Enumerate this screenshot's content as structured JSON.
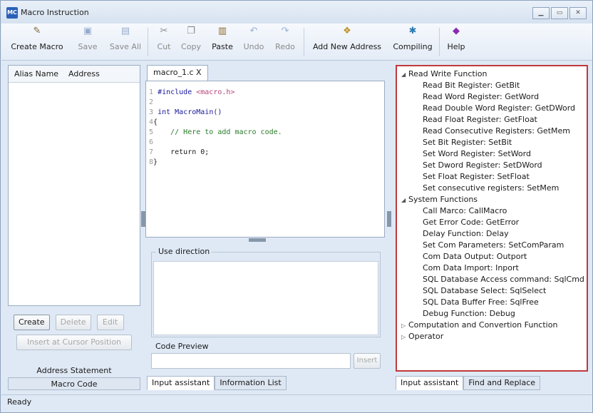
{
  "window": {
    "title": "Macro Instruction",
    "app_icon_text": "MC"
  },
  "toolbar": {
    "create_macro": "Create Macro",
    "save": "Save",
    "save_all": "Save All",
    "cut": "Cut",
    "copy": "Copy",
    "paste": "Paste",
    "undo": "Undo",
    "redo": "Redo",
    "add_new_address": "Add New Address",
    "compiling": "Compiling",
    "help": "Help"
  },
  "address_panel": {
    "col_alias": "Alias Name",
    "col_address": "Address",
    "create": "Create",
    "delete": "Delete",
    "edit": "Edit",
    "insert_at_cursor": "Insert at Cursor Position",
    "statement_label": "Address Statement",
    "tab_macro_code": "Macro Code"
  },
  "editor": {
    "tab_name": "macro_1.c X",
    "lines": [
      {
        "num": "1",
        "pre": "#include ",
        "str": "<macro.h>"
      },
      {
        "num": "2"
      },
      {
        "num": "3",
        "kw": "int ",
        "text": "MacroMain()"
      },
      {
        "num": "4",
        "text": "{"
      },
      {
        "num": "5",
        "cm": "    // Here to add macro code."
      },
      {
        "num": "6"
      },
      {
        "num": "7",
        "text": "    return 0;"
      },
      {
        "num": "8",
        "text": "}"
      }
    ],
    "use_direction_label": "Use direction",
    "code_preview_label": "Code Preview",
    "insert_btn": "Insert",
    "tab_input_assistant": "Input assistant",
    "tab_information_list": "Information List"
  },
  "function_tree": {
    "groups": [
      {
        "label": "Read Write Function",
        "expanded": true,
        "items": [
          "Read Bit Register: GetBit",
          "Read Word Register: GetWord",
          "Read Double Word Register: GetDWord",
          "Read Float Register: GetFloat",
          "Read Consecutive Registers: GetMem",
          "Set Bit Register: SetBit",
          "Set Word Register: SetWord",
          "Set Dword Register: SetDWord",
          "Set Float Register: SetFloat",
          "Set consecutive registers: SetMem"
        ]
      },
      {
        "label": "System Functions",
        "expanded": true,
        "items": [
          "Call Marco: CallMacro",
          "Get Error Code: GetError",
          "Delay Function: Delay",
          "Set Com Parameters: SetComParam",
          "Com Data Output: Outport",
          "Com Data Import: Inport",
          "SQL Database Access command: SqlCmd",
          "SQL Database Select: SqlSelect",
          "SQL Data Buffer Free: SqlFree",
          "Debug Function: Debug"
        ]
      },
      {
        "label": "Computation and Convertion Function",
        "expanded": false
      },
      {
        "label": "Operator",
        "expanded": false
      }
    ],
    "tab_input_assistant": "Input assistant",
    "tab_find_replace": "Find and Replace"
  },
  "status": {
    "text": "Ready"
  }
}
